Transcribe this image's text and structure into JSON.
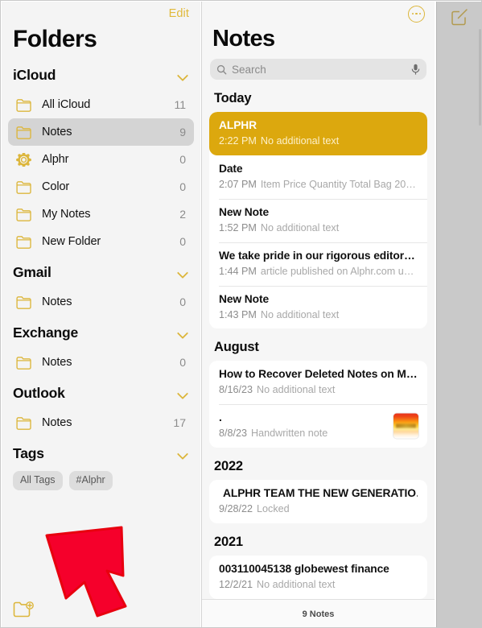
{
  "sidebar": {
    "edit_label": "Edit",
    "title": "Folders",
    "new_folder_icon": "new-folder-icon",
    "sections": [
      {
        "name": "iCloud",
        "chevron": "chevron-down-icon",
        "items": [
          {
            "icon": "folder-icon",
            "label": "All iCloud",
            "count": "11",
            "selected": false
          },
          {
            "icon": "folder-icon",
            "label": "Notes",
            "count": "9",
            "selected": true
          },
          {
            "icon": "gear-icon",
            "label": "Alphr",
            "count": "0",
            "selected": false
          },
          {
            "icon": "folder-icon",
            "label": "Color",
            "count": "0",
            "selected": false
          },
          {
            "icon": "folder-icon",
            "label": "My Notes",
            "count": "2",
            "selected": false
          },
          {
            "icon": "folder-icon",
            "label": "New Folder",
            "count": "0",
            "selected": false
          }
        ]
      },
      {
        "name": "Gmail",
        "chevron": "chevron-down-icon",
        "items": [
          {
            "icon": "folder-icon",
            "label": "Notes",
            "count": "0",
            "selected": false
          }
        ]
      },
      {
        "name": "Exchange",
        "chevron": "chevron-down-icon",
        "items": [
          {
            "icon": "folder-icon",
            "label": "Notes",
            "count": "0",
            "selected": false
          }
        ]
      },
      {
        "name": "Outlook",
        "chevron": "chevron-down-icon",
        "items": [
          {
            "icon": "folder-icon",
            "label": "Notes",
            "count": "17",
            "selected": false
          }
        ]
      }
    ],
    "tags_section": {
      "name": "Tags",
      "chevron": "chevron-down-icon",
      "chips": [
        "All Tags",
        "#Alphr"
      ]
    }
  },
  "notes": {
    "more_icon": "ellipsis-circle-icon",
    "title": "Notes",
    "search": {
      "icon": "search-icon",
      "placeholder": "Search",
      "value": "",
      "mic_icon": "microphone-icon"
    },
    "groups": [
      {
        "header": "Today",
        "items": [
          {
            "title": "ALPHR",
            "time": "2:22 PM",
            "preview": "No additional text",
            "selected": true,
            "locked": false,
            "thumb": false
          },
          {
            "title": "Date",
            "time": "2:07 PM",
            "preview": "Item Price Quantity Total Bag 20…",
            "selected": false,
            "locked": false,
            "thumb": false
          },
          {
            "title": "New Note",
            "time": "1:52 PM",
            "preview": "No additional text",
            "selected": false,
            "locked": false,
            "thumb": false
          },
          {
            "title": "We take pride in our rigorous editori…",
            "time": "1:44 PM",
            "preview": "article published on Alphr.com u…",
            "selected": false,
            "locked": false,
            "thumb": false
          },
          {
            "title": "New Note",
            "time": "1:43 PM",
            "preview": "No additional text",
            "selected": false,
            "locked": false,
            "thumb": false
          }
        ]
      },
      {
        "header": "August",
        "items": [
          {
            "title": "How to Recover Deleted Notes on M…",
            "time": "8/16/23",
            "preview": "No additional text",
            "selected": false,
            "locked": false,
            "thumb": false
          },
          {
            "title": ".",
            "time": "8/8/23",
            "preview": "Handwritten note",
            "selected": false,
            "locked": false,
            "thumb": true
          }
        ]
      },
      {
        "header": "2022",
        "items": [
          {
            "title": "ALPHR TEAM THE NEW GENERATIO…",
            "time": "9/28/22",
            "preview": "Locked",
            "selected": false,
            "locked": true,
            "thumb": false
          }
        ]
      },
      {
        "header": "2021",
        "items": [
          {
            "title": "003110045138 globewest finance",
            "time": "12/2/21",
            "preview": "No additional text",
            "selected": false,
            "locked": false,
            "thumb": false
          }
        ]
      }
    ],
    "footer_count": "9 Notes"
  },
  "detail": {
    "compose_icon": "compose-note-icon"
  },
  "annotation": {
    "arrow": "red-arrow-pointing-down-left"
  },
  "colors": {
    "accent_yellow": "#dcb63c",
    "selected_note": "#dca80e",
    "arrow_red": "#f5002b",
    "sidebar_bg": "#f4f4f4",
    "list_bg": "#f6f6f6",
    "detail_bg": "#c9c9c9"
  }
}
